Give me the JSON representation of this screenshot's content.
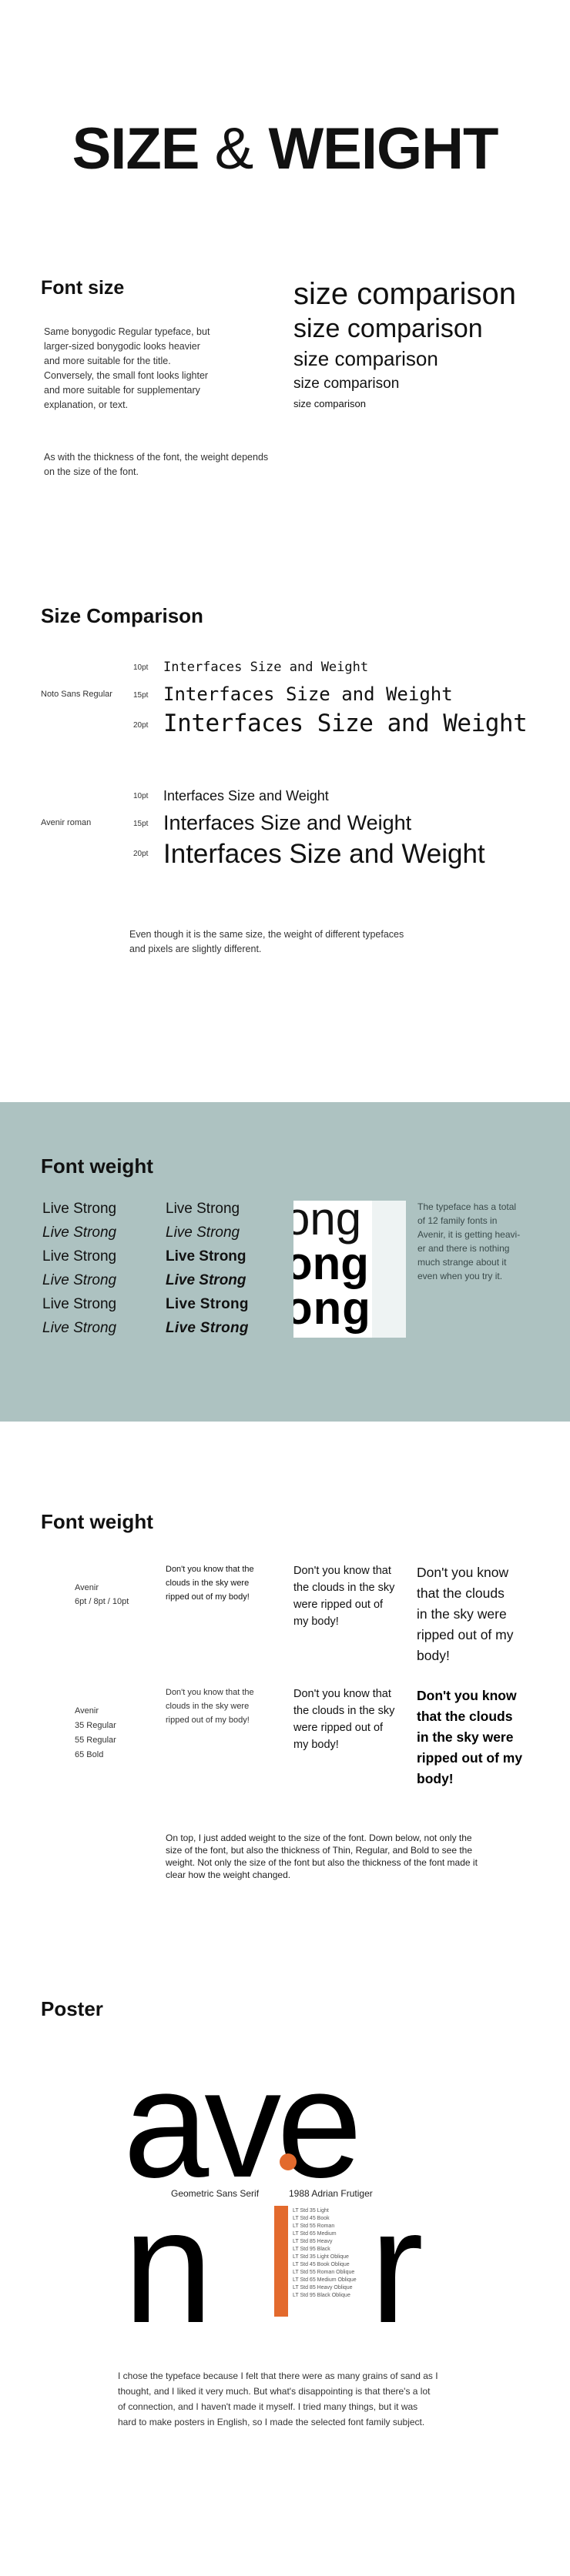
{
  "hero": {
    "title_a": "SIZE",
    "title_amp": "&",
    "title_b": "WEIGHT"
  },
  "font_size": {
    "heading": "Font size",
    "para1": [
      "Same bonygodic Regular typeface, but",
      "larger-sized bonygodic looks heavier",
      "and more suitable for the title.",
      "Conversely, the small font looks lighter",
      "and more suitable for supplementary",
      "explanation, or text."
    ],
    "para2": [
      "As with the thickness of the font, the weight depends",
      "on the size of the font."
    ],
    "samples": [
      "size comparison",
      "size comparison",
      "size comparison",
      "size comparison",
      "size comparison"
    ]
  },
  "size_comparison": {
    "heading": "Size Comparison",
    "groups": [
      {
        "font": "Noto Sans Regular",
        "rows": [
          {
            "pt": "10pt",
            "text": "Interfaces Size and Weight"
          },
          {
            "pt": "15pt",
            "text": "Interfaces Size and Weight"
          },
          {
            "pt": "20pt",
            "text": "Interfaces Size and Weight"
          }
        ]
      },
      {
        "font": "Avenir roman",
        "rows": [
          {
            "pt": "10pt",
            "text": "Interfaces Size and Weight"
          },
          {
            "pt": "15pt",
            "text": "Interfaces Size and Weight"
          },
          {
            "pt": "20pt",
            "text": "Interfaces Size and Weight"
          }
        ]
      }
    ],
    "note": [
      "Even though it is the same size, the weight of different typefaces",
      "and pixels are slightly different."
    ]
  },
  "font_weight_1": {
    "heading": "Font weight",
    "col1": [
      "Live Strong",
      "Live Strong",
      "Live Strong",
      "Live Strong",
      "Live Strong",
      "Live Strong"
    ],
    "col2": [
      "Live Strong",
      "Live Strong",
      "Live Strong",
      "Live Strong",
      "Live Strong",
      "Live Strong"
    ],
    "ong": [
      "ong",
      "ong",
      "ong"
    ],
    "note": [
      "The typeface has a total",
      "of 12 family fonts in",
      "Avenir, it is getting heavi-",
      "er and there is nothing",
      "much strange about it",
      "even when you try it."
    ],
    "band_color": "#adc2c1"
  },
  "font_weight_2": {
    "heading": "Font weight",
    "label1": [
      "Avenir",
      "6pt / 8pt / 10pt"
    ],
    "label2": [
      "Avenir",
      "35 Regular",
      "55 Regular",
      "65 Bold"
    ],
    "sentence": [
      "Don't you know that the",
      "clouds in the sky were",
      "ripped out of my body!"
    ],
    "sentence_mid": [
      "Don't you know that",
      "the clouds in the sky",
      "were ripped out of",
      "my body!"
    ],
    "sentence_big": [
      "Don't you know",
      "that the clouds",
      "in the sky were",
      "ripped out of my",
      "body!"
    ],
    "note": [
      "On top, I just added weight to the size of the font. Down below, not only the",
      "size of the font, but also the thickness of Thin, Regular, and Bold to see the",
      "weight. Not only the size of the font but also the thickness of the font made it",
      "clear how the weight changed."
    ]
  },
  "poster": {
    "heading": "Poster",
    "word_top": "ave",
    "word_bottom_l": "n",
    "word_bottom_r": "r",
    "caption_left": "Geometric Sans Serif",
    "caption_right": "1988 Adrian Frutiger",
    "accent": "#e36a2d",
    "family_list": [
      "LT Std 35 Light",
      "LT Std 45 Book",
      "LT Std 55 Roman",
      "LT Std 65 Medium",
      "LT Std 85 Heavy",
      "LT Std 95 Black",
      "LT Std 35 Light Oblique",
      "LT Std 45 Book Oblique",
      "LT Std 55 Roman Oblique",
      "LT Std 65 Medium Oblique",
      "LT Std 85 Heavy Oblique",
      "LT Std 95 Black Oblique"
    ],
    "note": [
      "I chose the typeface because I felt that there were as many grains of sand as I",
      "thought, and I liked it very much. But what's disappointing is that there's a lot",
      "of connection, and I haven't made it myself. I tried many things, but it was",
      "hard to make posters in English, so I made the selected font family subject."
    ]
  }
}
